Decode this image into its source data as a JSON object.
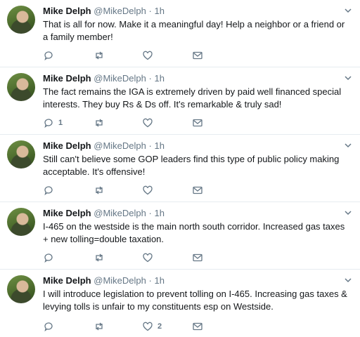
{
  "tweets": [
    {
      "name": "Mike Delph",
      "handle": "@MikeDelph",
      "dot": "·",
      "time": "1h",
      "text": "That is all for now. Make it a meaningful day! Help a neighbor or a friend or a family member!",
      "reply_count": "",
      "retweet_count": "",
      "like_count": ""
    },
    {
      "name": "Mike Delph",
      "handle": "@MikeDelph",
      "dot": "·",
      "time": "1h",
      "text": "The fact remains the IGA is extremely driven by paid well financed special interests. They buy Rs & Ds off. It's remarkable & truly sad!",
      "reply_count": "1",
      "retweet_count": "",
      "like_count": ""
    },
    {
      "name": "Mike Delph",
      "handle": "@MikeDelph",
      "dot": "·",
      "time": "1h",
      "text": "Still can't believe some GOP leaders find this type of public policy making acceptable. It's offensive!",
      "reply_count": "",
      "retweet_count": "",
      "like_count": ""
    },
    {
      "name": "Mike Delph",
      "handle": "@MikeDelph",
      "dot": "·",
      "time": "1h",
      "text": "I-465 on the westside is the main north south corridor. Increased gas taxes + new tolling=double taxation.",
      "reply_count": "",
      "retweet_count": "",
      "like_count": ""
    },
    {
      "name": "Mike Delph",
      "handle": "@MikeDelph",
      "dot": "·",
      "time": "1h",
      "text": "I will introduce legislation to prevent tolling on I-465. Increasing gas taxes & levying tolls is unfair to my constituents esp on Westside.",
      "reply_count": "",
      "retweet_count": "",
      "like_count": "2"
    }
  ],
  "icons": {
    "reply": "reply-icon",
    "retweet": "retweet-icon",
    "like": "heart-icon",
    "message": "envelope-icon",
    "caret": "chevron-down-icon"
  },
  "colors": {
    "icon_gray": "#657786",
    "text": "#14171a",
    "divider": "#e6ecf0"
  }
}
